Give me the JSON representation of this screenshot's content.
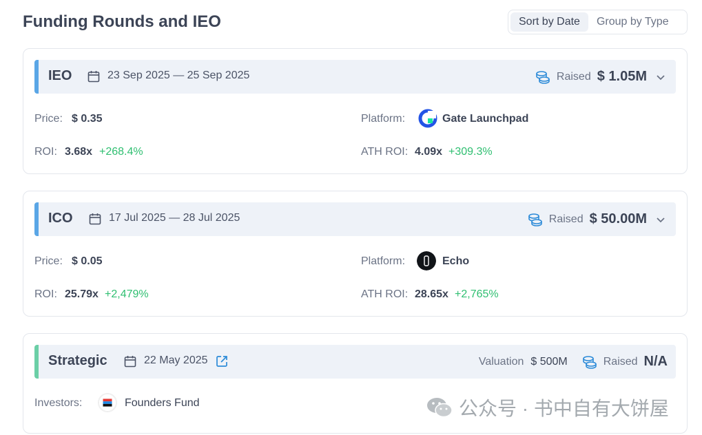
{
  "header": {
    "title": "Funding Rounds and IEO",
    "sort_options": [
      "Sort by Date",
      "Group by Type"
    ],
    "active_sort": "Sort by Date"
  },
  "rounds": [
    {
      "type": "IEO",
      "date": "23 Sep 2025 — 25 Sep 2025",
      "raised_label": "Raised",
      "raised": "$ 1.05M",
      "price_label": "Price:",
      "price": "$ 0.35",
      "platform_label": "Platform:",
      "platform": "Gate Launchpad",
      "roi_label": "ROI:",
      "roi": "3.68x",
      "roi_pct": "+268.4%",
      "ath_roi_label": "ATH ROI:",
      "ath_roi": "4.09x",
      "ath_roi_pct": "+309.3%"
    },
    {
      "type": "ICO",
      "date": "17 Jul 2025 — 28 Jul 2025",
      "raised_label": "Raised",
      "raised": "$ 50.00M",
      "price_label": "Price:",
      "price": "$ 0.05",
      "platform_label": "Platform:",
      "platform": "Echo",
      "roi_label": "ROI:",
      "roi": "25.79x",
      "roi_pct": "+2,479%",
      "ath_roi_label": "ATH ROI:",
      "ath_roi": "28.65x",
      "ath_roi_pct": "+2,765%"
    },
    {
      "type": "Strategic",
      "date": "22 May 2025",
      "valuation_label": "Valuation",
      "valuation": "$ 500M",
      "raised_label": "Raised",
      "raised": "N/A",
      "investors_label": "Investors:",
      "investor": "Founders Fund"
    }
  ],
  "watermark": "公众号 · 书中自有大饼屋",
  "colors": {
    "accent_blue": "#5aa6e6",
    "accent_green": "#6bcfa6",
    "positive": "#2fbf71",
    "icon_blue": "#2b8ad8"
  }
}
